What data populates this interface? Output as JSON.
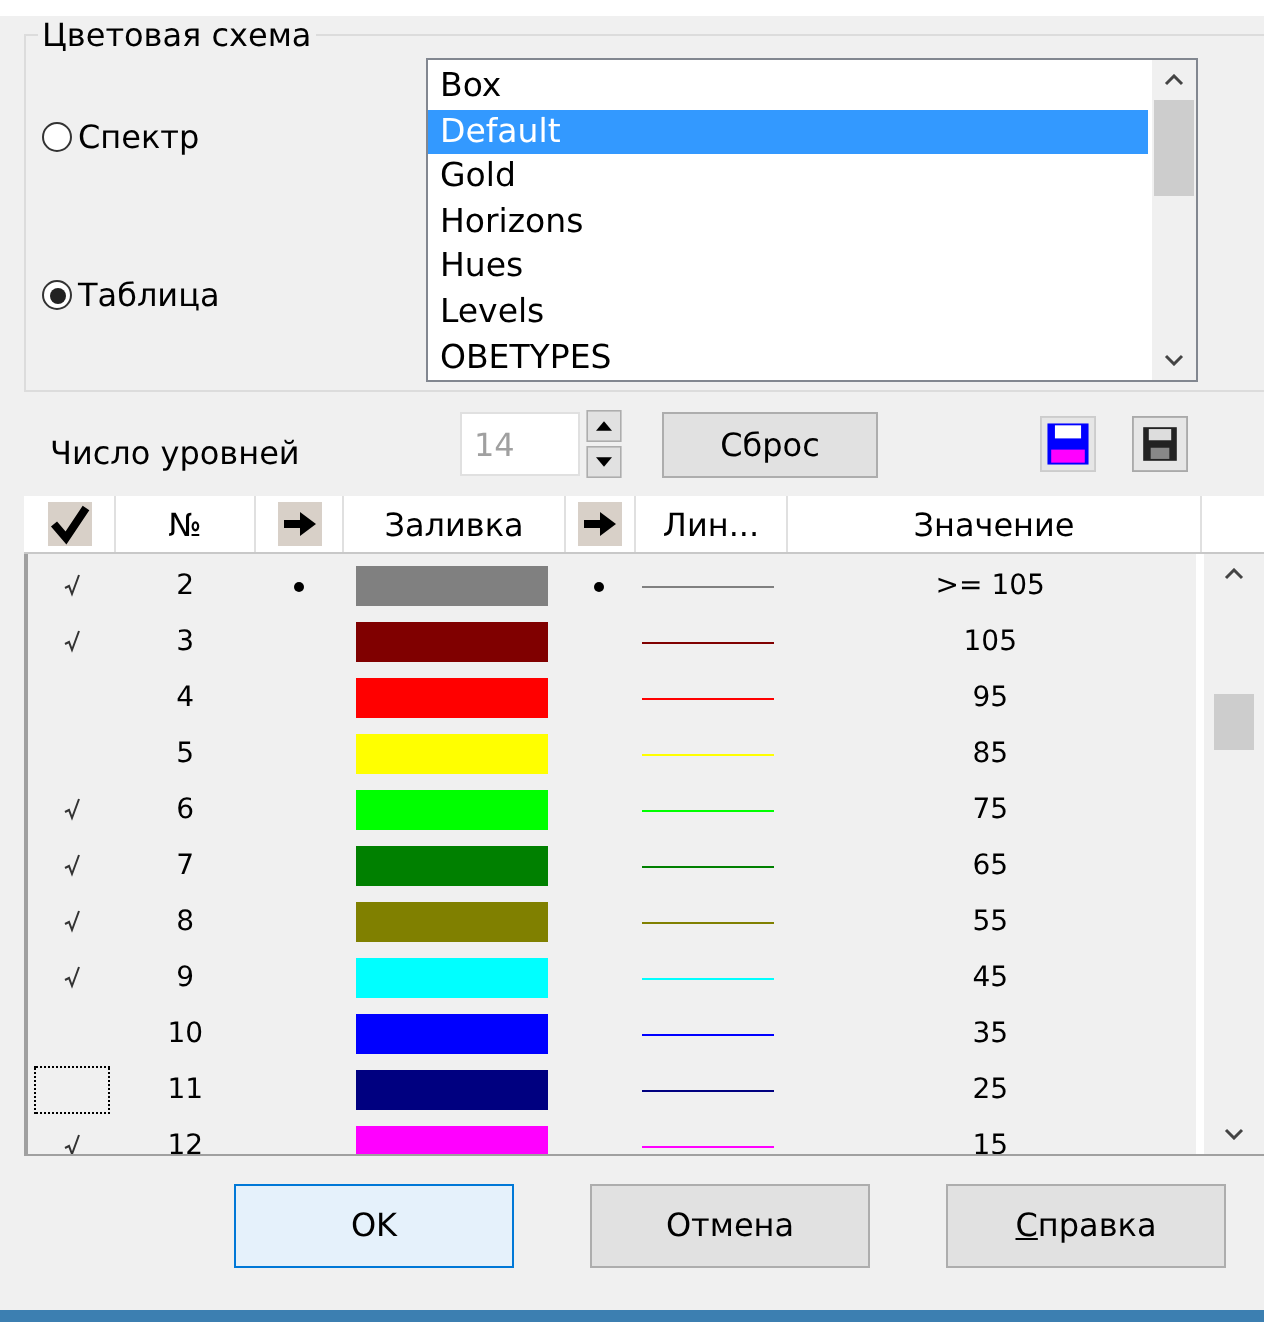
{
  "color_scheme": {
    "title": "Цветовая схема",
    "modes": [
      {
        "label": "Спектр",
        "selected": false
      },
      {
        "label": "Таблица",
        "selected": true
      }
    ],
    "schemes": [
      {
        "label": "Box",
        "selected": false
      },
      {
        "label": "Default",
        "selected": true
      },
      {
        "label": "Gold",
        "selected": false
      },
      {
        "label": "Horizons",
        "selected": false
      },
      {
        "label": "Hues",
        "selected": false
      },
      {
        "label": "Levels",
        "selected": false
      },
      {
        "label": "OBETYPES",
        "selected": false
      }
    ]
  },
  "levels": {
    "label": "Число уровней",
    "value": "14",
    "disabled": true,
    "reset_button": "Сброс"
  },
  "table": {
    "columns": [
      "№",
      "Заливка",
      "Лин...",
      "Значение"
    ],
    "rows": [
      {
        "checked": true,
        "number": "2",
        "fill_dot": true,
        "fill": {
          "color": "#808080"
        },
        "line_dot": true,
        "line": {
          "color": "#808080"
        },
        "value": ">= 105",
        "focused": false
      },
      {
        "checked": true,
        "number": "3",
        "fill_dot": false,
        "fill": {
          "color": "#800000"
        },
        "line_dot": false,
        "line": {
          "color": "#800000"
        },
        "value": "105",
        "focused": false
      },
      {
        "checked": false,
        "number": "4",
        "fill_dot": false,
        "fill": {
          "color": "#ff0000"
        },
        "line_dot": false,
        "line": {
          "color": "#ff0000"
        },
        "value": "95",
        "focused": false
      },
      {
        "checked": false,
        "number": "5",
        "fill_dot": false,
        "fill": {
          "color": "#ffff00"
        },
        "line_dot": false,
        "line": {
          "color": "#ffff00"
        },
        "value": "85",
        "focused": false
      },
      {
        "checked": true,
        "number": "6",
        "fill_dot": false,
        "fill": {
          "color": "#00ff00"
        },
        "line_dot": false,
        "line": {
          "color": "#00ff00"
        },
        "value": "75",
        "focused": false
      },
      {
        "checked": true,
        "number": "7",
        "fill_dot": false,
        "fill": {
          "color": "#008000"
        },
        "line_dot": false,
        "line": {
          "color": "#008000"
        },
        "value": "65",
        "focused": false
      },
      {
        "checked": true,
        "number": "8",
        "fill_dot": false,
        "fill": {
          "color": "#808000"
        },
        "line_dot": false,
        "line": {
          "color": "#808000"
        },
        "value": "55",
        "focused": false
      },
      {
        "checked": true,
        "number": "9",
        "fill_dot": false,
        "fill": {
          "color": "#00ffff"
        },
        "line_dot": false,
        "line": {
          "color": "#00ffff"
        },
        "value": "45",
        "focused": false
      },
      {
        "checked": false,
        "number": "10",
        "fill_dot": false,
        "fill": {
          "color": "#0000ff"
        },
        "line_dot": false,
        "line": {
          "color": "#0000ff"
        },
        "value": "35",
        "focused": false
      },
      {
        "checked": false,
        "number": "11",
        "fill_dot": false,
        "fill": {
          "color": "#000080"
        },
        "line_dot": false,
        "line": {
          "color": "#000080"
        },
        "value": "25",
        "focused": true
      },
      {
        "checked": true,
        "number": "12",
        "fill_dot": false,
        "fill": {
          "color": "#ff00ff"
        },
        "line_dot": false,
        "line": {
          "color": "#ff00ff"
        },
        "value": "15",
        "focused": false
      }
    ]
  },
  "buttons": [
    {
      "label": "OK",
      "default": true,
      "underline_first": false
    },
    {
      "label": "Отмена",
      "default": false,
      "underline_first": false
    },
    {
      "label": "Справка",
      "default": false,
      "underline_first": true
    }
  ]
}
